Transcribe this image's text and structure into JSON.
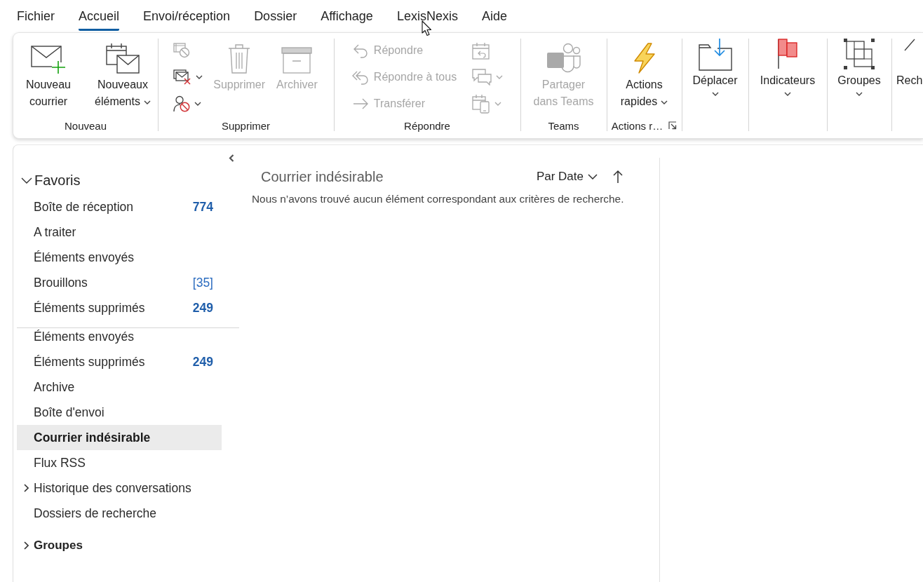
{
  "menu_tabs": [
    {
      "label": "Fichier",
      "selected": false
    },
    {
      "label": "Accueil",
      "selected": true
    },
    {
      "label": "Envoi/réception",
      "selected": false
    },
    {
      "label": "Dossier",
      "selected": false
    },
    {
      "label": "Affichage",
      "selected": false
    },
    {
      "label": "LexisNexis",
      "selected": false
    },
    {
      "label": "Aide",
      "selected": false
    }
  ],
  "ribbon": {
    "groups": [
      {
        "label": "Nouveau",
        "buttons": [
          {
            "kind": "large",
            "label": "Nouveau courrier",
            "disabled": false,
            "dropdown": false
          },
          {
            "kind": "large",
            "label": "Nouveaux éléments",
            "disabled": false,
            "dropdown": true
          }
        ]
      },
      {
        "label": "Supprimer",
        "buttons": [
          {
            "kind": "small",
            "disabled": true,
            "dropdown": false
          },
          {
            "kind": "small",
            "disabled": false,
            "dropdown": true
          },
          {
            "kind": "small",
            "disabled": false,
            "dropdown": true
          },
          {
            "kind": "large",
            "label": "Supprimer",
            "disabled": true,
            "dropdown": false
          },
          {
            "kind": "large",
            "label": "Archiver",
            "disabled": true,
            "dropdown": false
          }
        ]
      },
      {
        "label": "Répondre",
        "buttons": [
          {
            "kind": "row",
            "label": "Répondre",
            "disabled": true,
            "dropdown": false
          },
          {
            "kind": "row",
            "label": "Répondre à tous",
            "disabled": true,
            "dropdown": false
          },
          {
            "kind": "row",
            "label": "Transférer",
            "disabled": true,
            "dropdown": false
          },
          {
            "kind": "small",
            "disabled": true,
            "dropdown": false
          },
          {
            "kind": "small",
            "disabled": true,
            "dropdown": true
          },
          {
            "kind": "small",
            "disabled": true,
            "dropdown": true
          }
        ]
      },
      {
        "label": "Teams",
        "buttons": [
          {
            "kind": "large",
            "label": "Partager dans Teams",
            "disabled": true,
            "dropdown": false
          }
        ]
      },
      {
        "label": "Actions r…",
        "launcher": true,
        "buttons": [
          {
            "kind": "large",
            "label": "Actions rapides",
            "disabled": false,
            "dropdown": true
          }
        ]
      },
      {
        "buttons": [
          {
            "kind": "menu",
            "label": "Déplacer",
            "disabled": false,
            "dropdown": true
          }
        ]
      },
      {
        "buttons": [
          {
            "kind": "menu",
            "label": "Indicateurs",
            "disabled": false,
            "dropdown": true
          }
        ]
      },
      {
        "buttons": [
          {
            "kind": "menu",
            "label": "Groupes",
            "disabled": false,
            "dropdown": true
          }
        ]
      },
      {
        "buttons": [
          {
            "kind": "menu",
            "label": "Rech",
            "disabled": false,
            "dropdown": false
          }
        ]
      }
    ]
  },
  "navigation": {
    "favorites": {
      "label": "Favoris",
      "expanded": true,
      "items": [
        {
          "label": "Boîte de réception",
          "count": {
            "text": "774",
            "kind": "unread"
          },
          "selected": false
        },
        {
          "label": "A traiter",
          "selected": false
        },
        {
          "label": "Éléments envoyés",
          "selected": false
        },
        {
          "label": "Brouillons",
          "count": {
            "text": "[35]",
            "kind": "total"
          },
          "selected": false
        },
        {
          "label": "Éléments supprimés",
          "count": {
            "text": "249",
            "kind": "unread"
          },
          "selected": false
        }
      ]
    },
    "folders": [
      {
        "label": "Éléments envoyés",
        "selected": false
      },
      {
        "label": "Éléments supprimés",
        "count": {
          "text": "249",
          "kind": "unread"
        },
        "selected": false
      },
      {
        "label": "Archive",
        "selected": false
      },
      {
        "label": "Boîte d'envoi",
        "selected": false
      },
      {
        "label": "Courrier indésirable",
        "selected": true
      },
      {
        "label": "Flux RSS",
        "selected": false
      },
      {
        "label": "Historique des conversations",
        "selected": false,
        "expanded": false
      },
      {
        "label": "Dossiers de recherche",
        "selected": false
      }
    ],
    "groups": {
      "label": "Groupes",
      "expanded": false
    }
  },
  "mail_list": {
    "title": "Courrier indésirable",
    "sort": {
      "label": "Par Date",
      "ascending": true
    },
    "empty_message": "Nous n’avons trouvé aucun élément correspondant aux critères de recherche."
  }
}
